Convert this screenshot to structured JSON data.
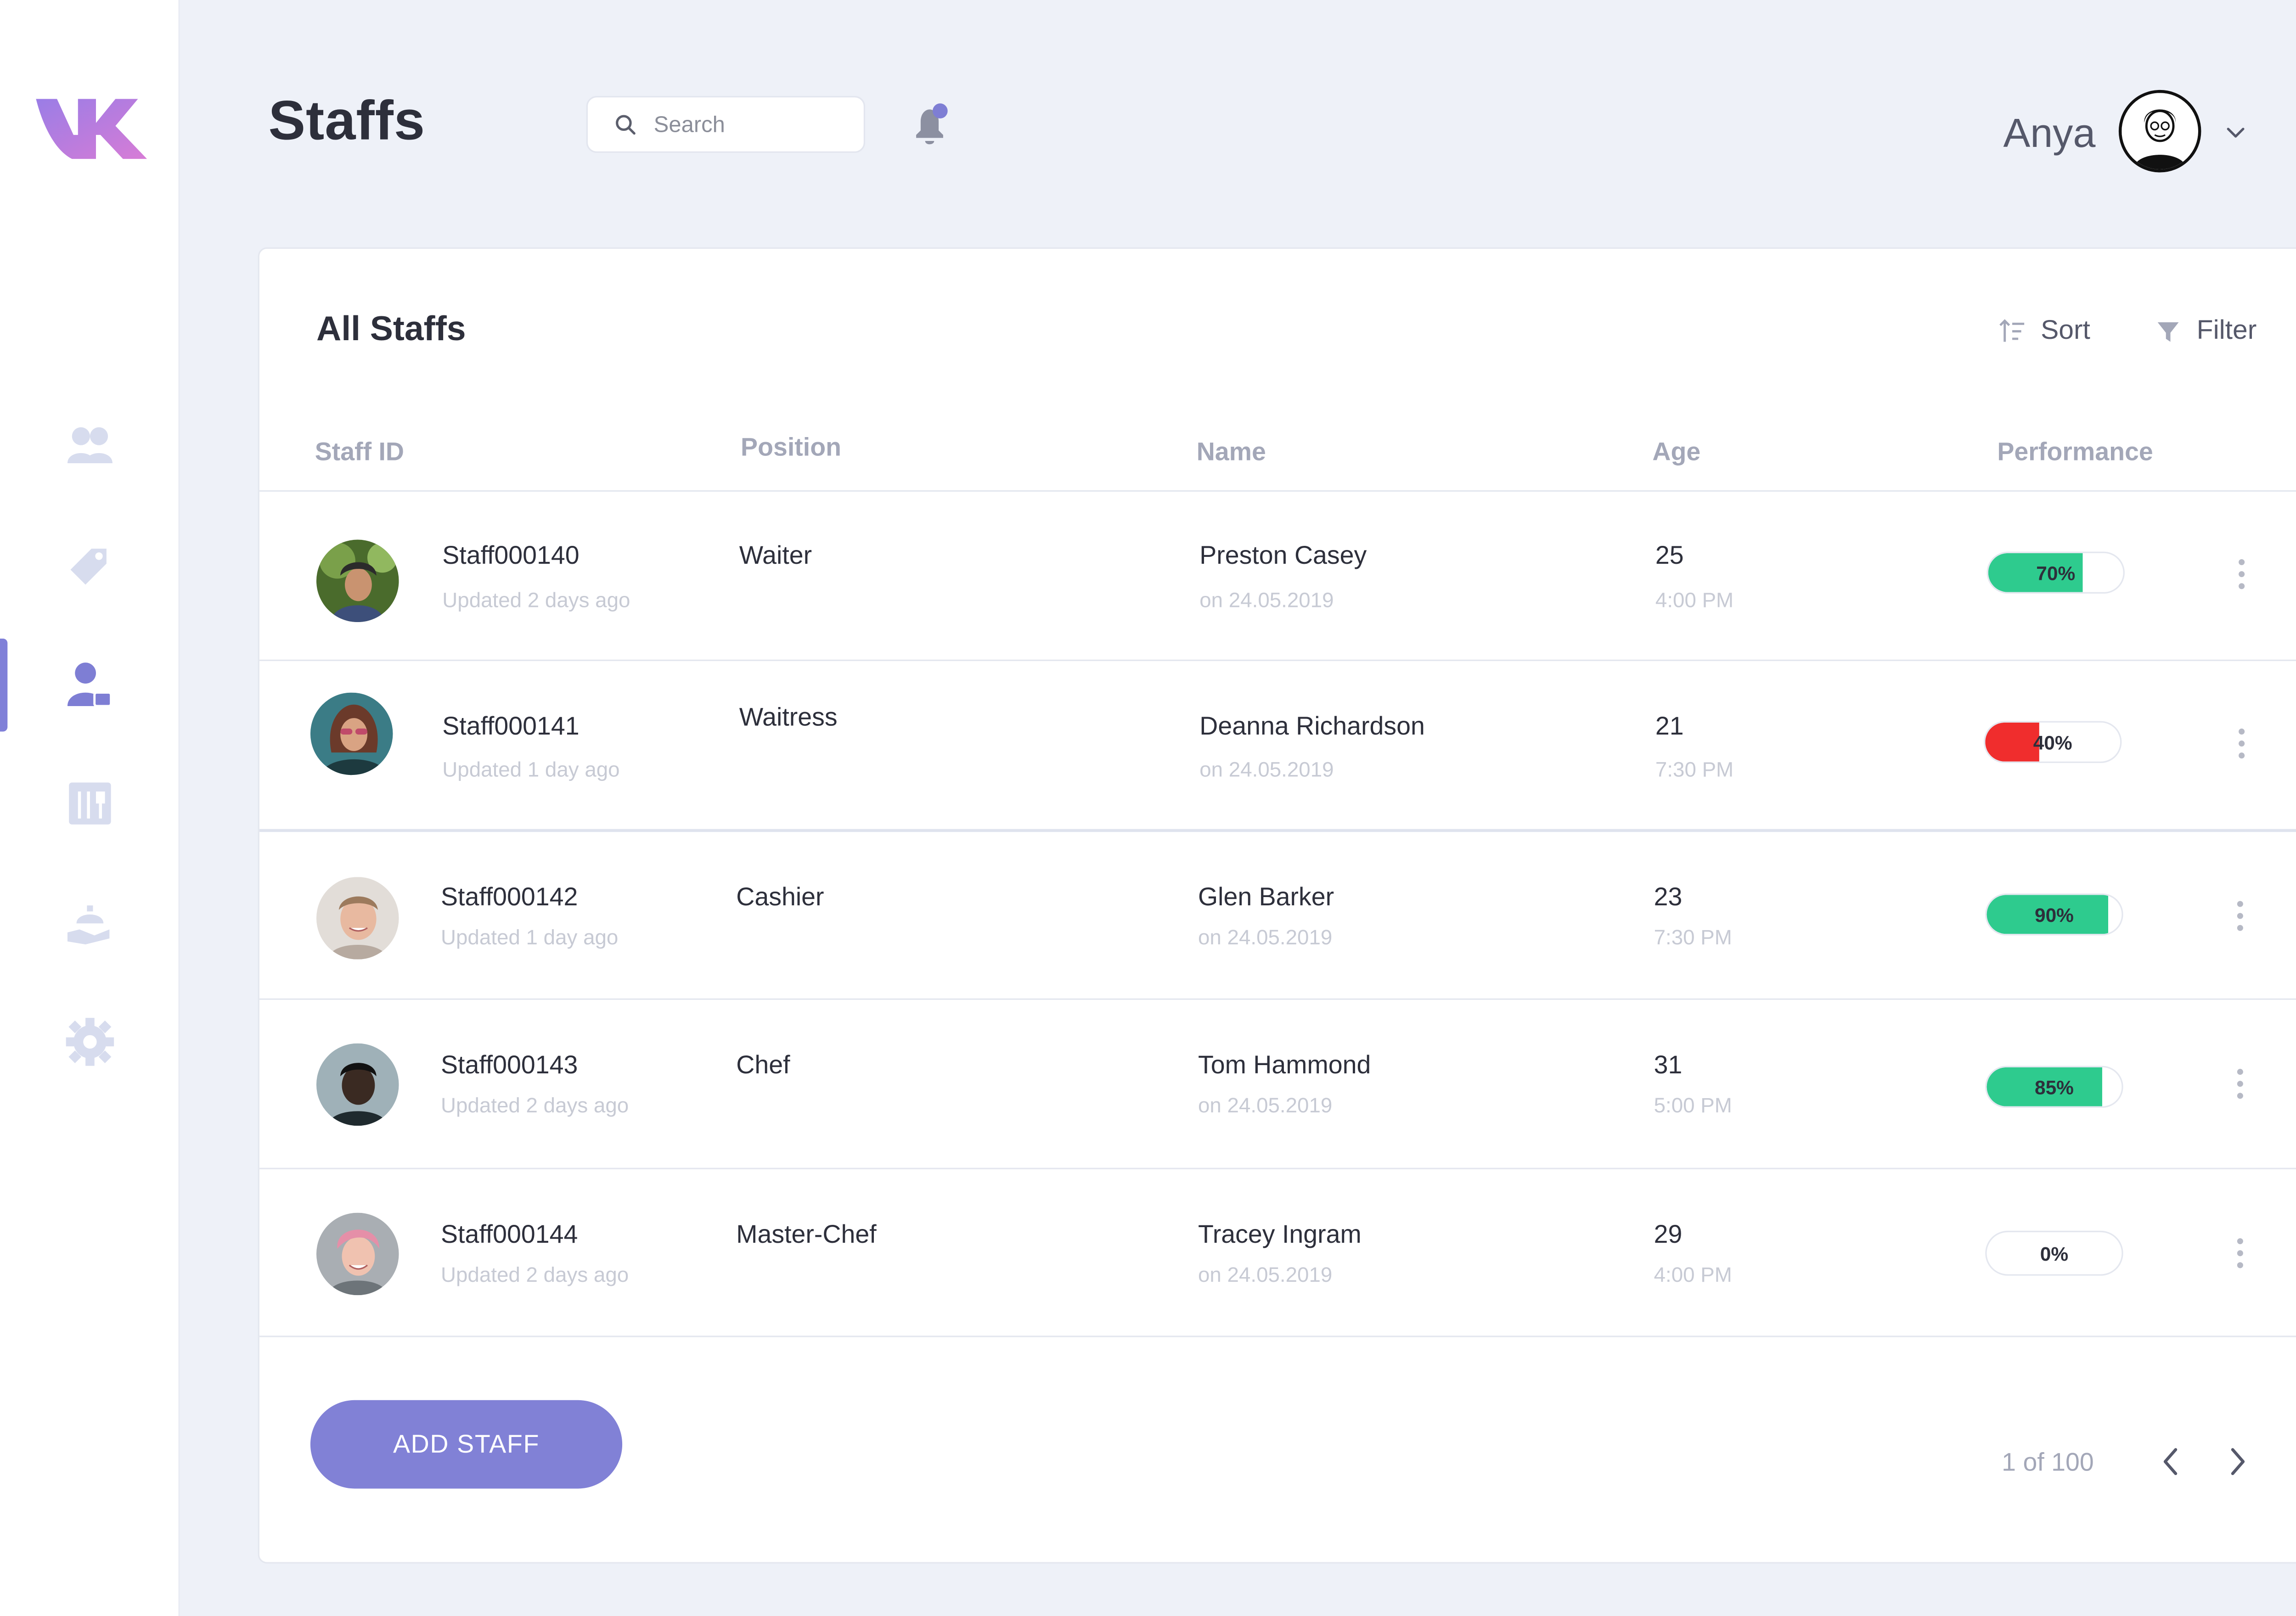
{
  "header": {
    "title": "Staffs",
    "search_placeholder": "Search",
    "user_name": "Anya"
  },
  "card": {
    "title": "All Staffs",
    "sort_label": "Sort",
    "filter_label": "Filter",
    "columns": [
      "Staff ID",
      "Position",
      "Name",
      "Age",
      "Performance"
    ],
    "rows": [
      {
        "id": "Staff000140",
        "updated": "Updated 2 days ago",
        "position": "Waiter",
        "name": "Preston Casey",
        "date": "on 24.05.2019",
        "age": "25",
        "time": "4:00 PM",
        "performance": 0.7,
        "perf_label": "70%",
        "perf_color": "#2ecb8e"
      },
      {
        "id": "Staff000141",
        "updated": "Updated 1 day ago",
        "position": "Waitress",
        "name": "Deanna Richardson",
        "date": "on 24.05.2019",
        "age": "21",
        "time": "7:30 PM",
        "performance": 0.4,
        "perf_label": "40%",
        "perf_color": "#f02d2d"
      },
      {
        "id": "Staff000142",
        "updated": "Updated 1 day ago",
        "position": "Cashier",
        "name": "Glen Barker",
        "date": "on 24.05.2019",
        "age": "23",
        "time": "7:30 PM",
        "performance": 0.9,
        "perf_label": "90%",
        "perf_color": "#2ecb8e"
      },
      {
        "id": "Staff000143",
        "updated": "Updated 2 days ago",
        "position": "Chef",
        "name": "Tom Hammond",
        "date": "on 24.05.2019",
        "age": "31",
        "time": "5:00 PM",
        "performance": 0.85,
        "perf_label": "85%",
        "perf_color": "#2ecb8e"
      },
      {
        "id": "Staff000144",
        "updated": "Updated 2 days ago",
        "position": "Master-Chef",
        "name": "Tracey Ingram",
        "date": "on 24.05.2019",
        "age": "29",
        "time": "4:00 PM",
        "performance": 0.0,
        "perf_label": "0%",
        "perf_color": "#2ecb8e"
      }
    ],
    "add_button_label": "ADD STAFF",
    "pagination": "1 of 100"
  },
  "sidebar": {
    "items": [
      "users-icon",
      "tag-icon",
      "staff-icon",
      "menu-icon",
      "service-icon",
      "settings-icon"
    ],
    "active": "staff-icon"
  },
  "colors": {
    "accent": "#8181d6",
    "good": "#2ecb8e",
    "bad": "#f02d2d",
    "background": "#eef1f8"
  }
}
